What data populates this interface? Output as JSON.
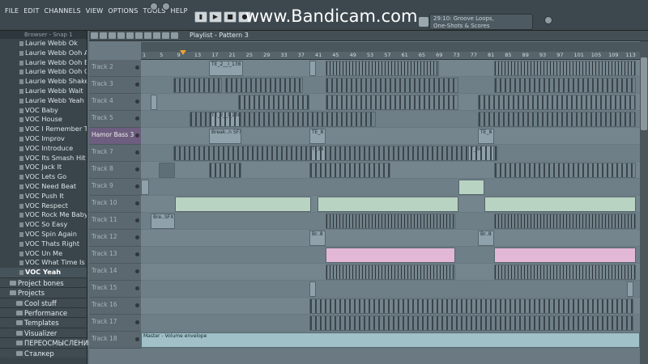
{
  "menu": [
    "FILE",
    "EDIT",
    "CHANNELS",
    "VIEW",
    "OPTIONS",
    "TOOLS",
    "HELP"
  ],
  "watermark": "www.Bandicam.com",
  "hint": {
    "line1": "29:10: Groove Loops,",
    "line2": "One-Shots & Scores"
  },
  "browser": {
    "header": "Browser - Snap 1",
    "items": [
      "Laurie Webb Ok",
      "Laurie Webb Ooh A",
      "Laurie Webb Ooh B",
      "Laurie Webb Ooh C",
      "Laurie Webb Shake",
      "Laurie Webb Wait",
      "Laurie Webb Yeah",
      "VOC Baby",
      "VOC House",
      "VOC I Remember That",
      "VOC Improv",
      "VOC Introduce",
      "VOC Its Smash Hit",
      "VOC Jack It",
      "VOC Lets Go",
      "VOC Need Beat",
      "VOC Push It",
      "VOC Respect",
      "VOC Rock Me Baby",
      "VOC So Easy",
      "VOC Spin Again",
      "VOC Thats Right",
      "VOC Un Me",
      "VOC What Time Is It",
      "VOC Yeah"
    ],
    "selected_index": 24,
    "folders": [
      {
        "label": "Project bones",
        "sub": false
      },
      {
        "label": "Projects",
        "sub": false
      },
      {
        "label": "Cool stuff",
        "sub": true
      },
      {
        "label": "Performance mode",
        "sub": true
      },
      {
        "label": "Templates",
        "sub": true
      },
      {
        "label": "Visualizer",
        "sub": true
      },
      {
        "label": "ПЕРЕОСМЫСЛЕНИЕ",
        "sub": true
      },
      {
        "label": "Сталкер",
        "sub": true
      }
    ]
  },
  "playlist": {
    "title": "Playlist - Pattern 3",
    "ruler": [
      "1",
      "5",
      "9",
      "13",
      "17",
      "21",
      "25",
      "29",
      "33",
      "37",
      "41",
      "45",
      "49",
      "53",
      "57",
      "61",
      "65",
      "69",
      "73",
      "77",
      "81",
      "85",
      "89",
      "93",
      "97",
      "101",
      "105",
      "109",
      "113",
      "117"
    ],
    "tracks": [
      "Track 2",
      "Track 3",
      "Track 4",
      "Track 5",
      "Hamor Bass 3",
      "Track 7",
      "Track 8",
      "Track 9",
      "Track 10",
      "Track 11",
      "Track 12",
      "Track 13",
      "Track 14",
      "Track 15",
      "Track 16",
      "Track 17",
      "Track 18"
    ],
    "highlight_track": 4,
    "clip_labels": {
      "te": "TE_2__I_138",
      "te2": "TE_2__I_138",
      "break": "Break..n SFX",
      "te_short": "TE_8",
      "t38": "T_38",
      "bre": "Bre..SFX",
      "br": "Br..8",
      "master": "Master - Volume envelope"
    }
  }
}
